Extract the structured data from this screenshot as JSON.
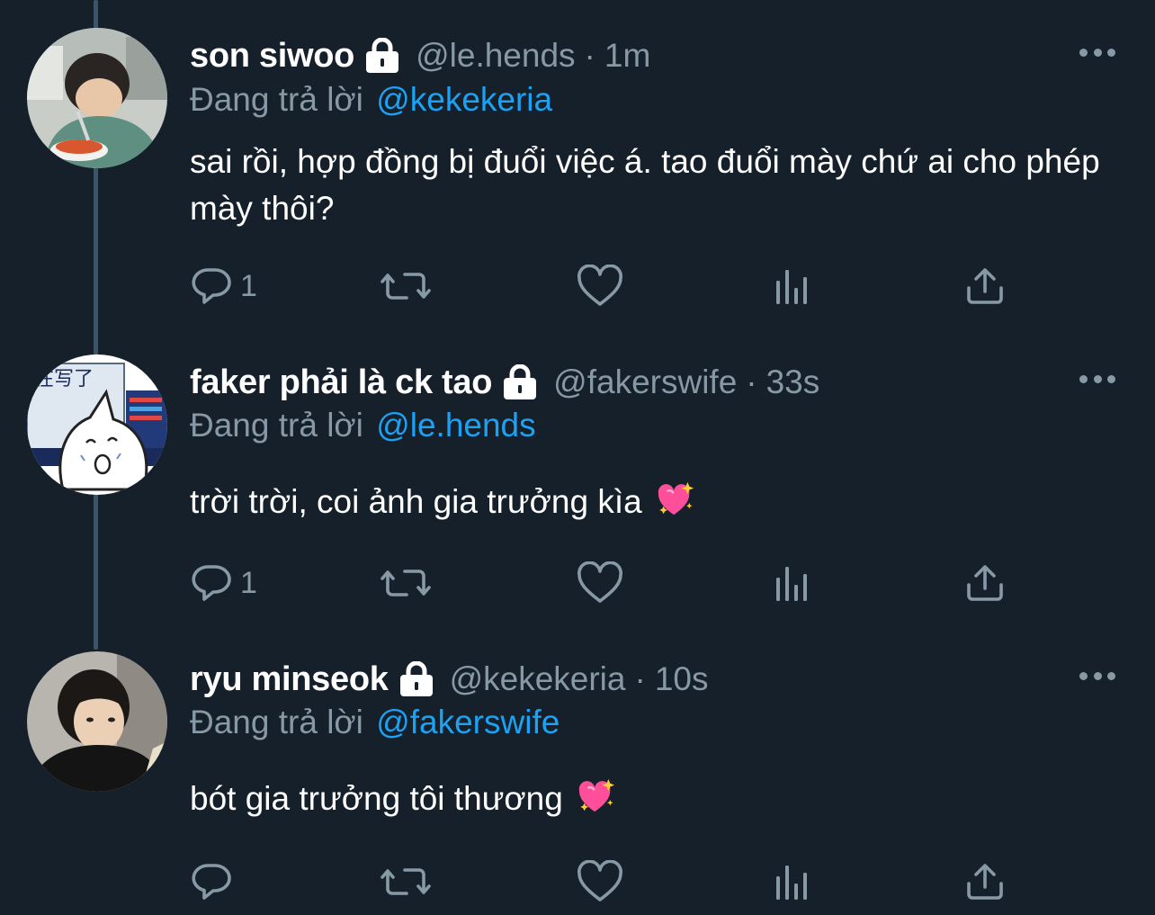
{
  "tweets": [
    {
      "name": "son siwoo",
      "handle": "@le.hends",
      "separator": "·",
      "time": "1m",
      "replying_prefix": "Đang trả lời",
      "replying_to": "@kekekeria",
      "text": "sai rồi, hợp đồng bị đuổi việc á. tao đuổi mày chứ ai cho phép mày thôi?",
      "reply_count": "1",
      "avatar_icon": "avatar-photo-eating"
    },
    {
      "name": "faker phải là ck tao",
      "handle": "@fakerswife",
      "separator": "·",
      "time": "33s",
      "replying_prefix": "Đang trả lời",
      "replying_to": "@le.hends",
      "text": "trời trời, coi ảnh gia trưởng kìa",
      "emoji": "sparkling-heart",
      "reply_count": "1",
      "avatar_icon": "avatar-cartoon-cat"
    },
    {
      "name": "ryu minseok",
      "handle": "@kekekeria",
      "separator": "·",
      "time": "10s",
      "replying_prefix": "Đang trả lời",
      "replying_to": "@fakerswife",
      "text": "bót gia trưởng tôi thương",
      "emoji": "sparkling-heart",
      "reply_count": "",
      "avatar_icon": "avatar-photo-portrait"
    }
  ],
  "avatar_text": "在写了",
  "colors": {
    "background": "#15202b",
    "text": "#ffffff",
    "secondary": "#8899a6",
    "link": "#1da1f2",
    "thread_line": "#3d5466",
    "heart_emoji": "#ff4f9b"
  }
}
